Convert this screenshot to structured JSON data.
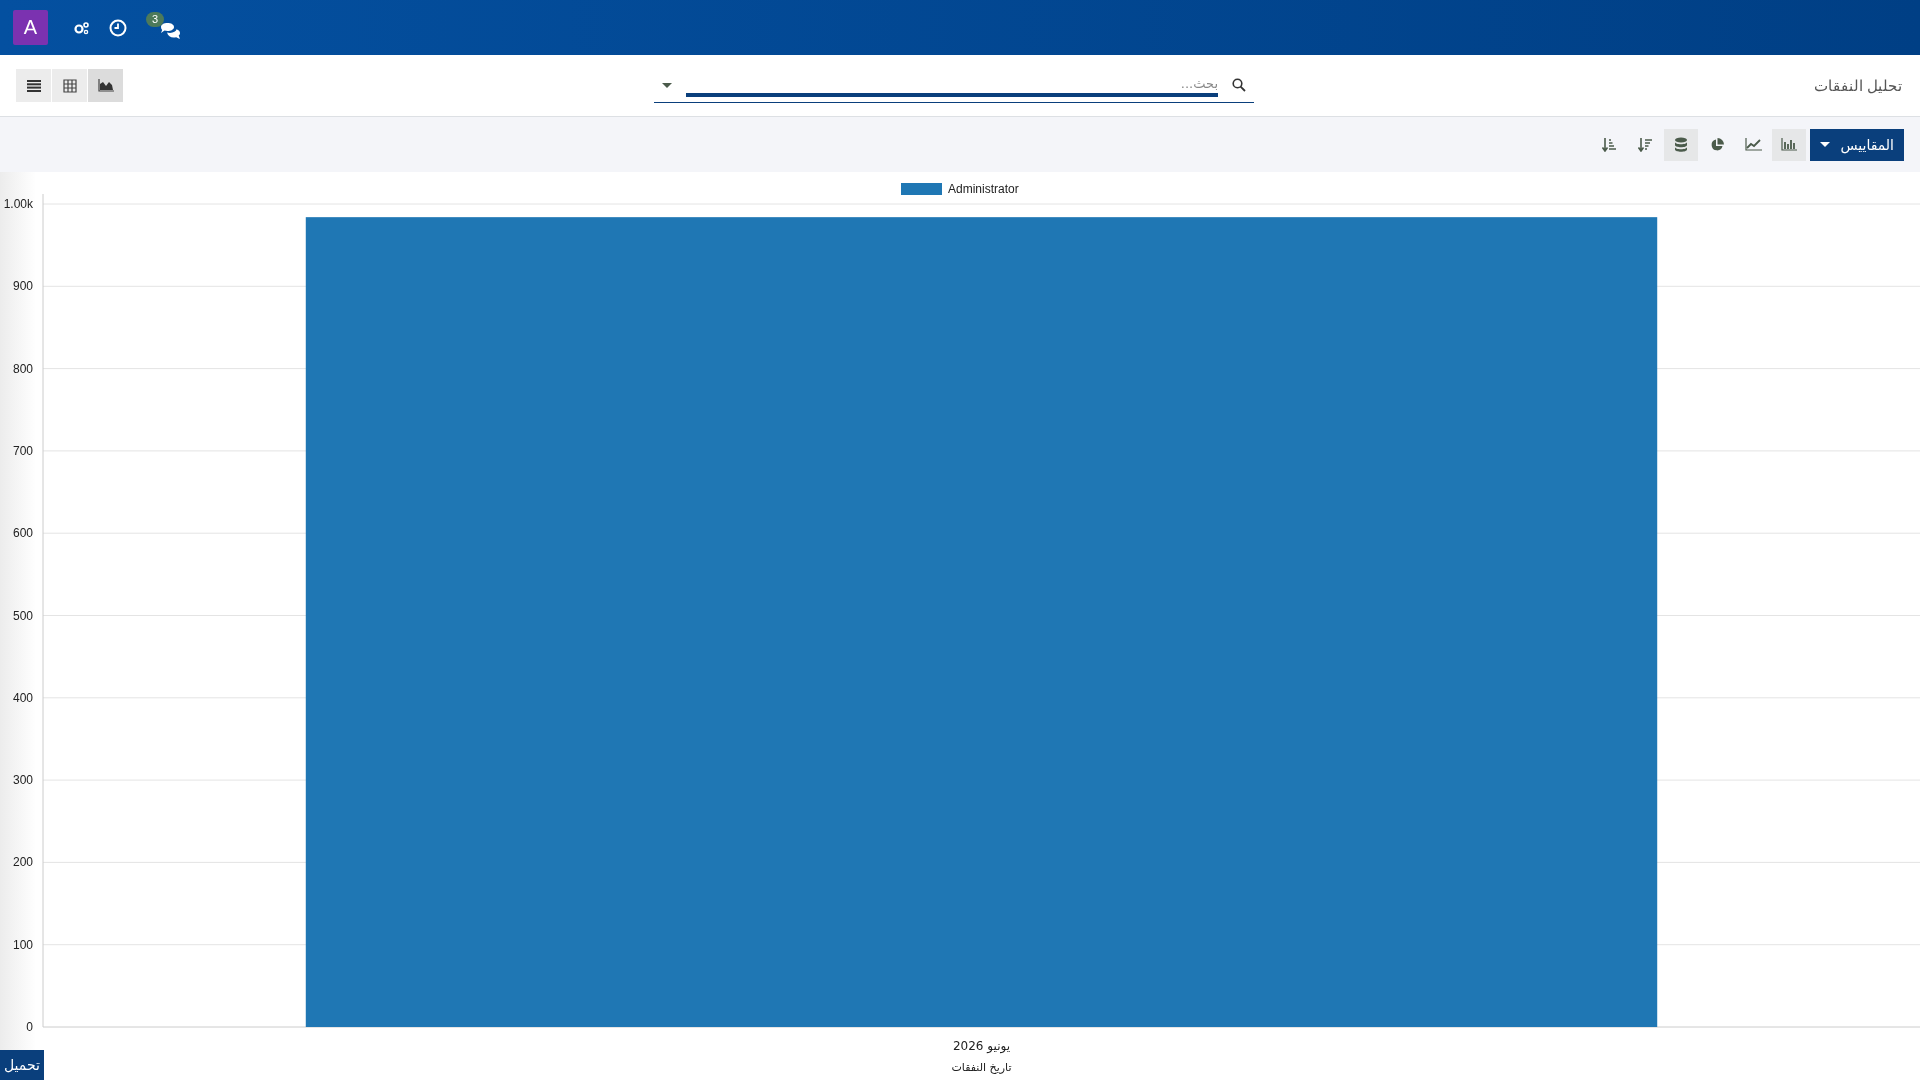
{
  "top_bar": {
    "avatar": "A",
    "chat_badge": "3"
  },
  "control_panel": {
    "title": "تحليل النفقات",
    "search": {
      "placeholder": "بحث..."
    },
    "views": [
      {
        "kind": "list",
        "selected": false
      },
      {
        "kind": "pivot",
        "selected": false
      },
      {
        "kind": "graph",
        "selected": true
      }
    ]
  },
  "toolbar": {
    "measures": "المقاييس",
    "buttons": [
      {
        "kind": "bar",
        "selected": true
      },
      {
        "kind": "line",
        "selected": false
      },
      {
        "kind": "pie",
        "selected": false
      },
      {
        "kind": "stack",
        "selected": true
      },
      {
        "kind": "sort_desc",
        "selected": false
      },
      {
        "kind": "sort_asc",
        "selected": false
      }
    ]
  },
  "chart": {
    "chart_data": {
      "type": "bar",
      "xlabel": "تاريخ النفقات",
      "categories": [
        "يونيو 2026"
      ],
      "series": [
        {
          "name": "Administrator",
          "color": "#1f77b4",
          "values": [
            984
          ]
        }
      ],
      "grid": true,
      "ylim": [
        0,
        1000
      ],
      "yticks": [
        0,
        100,
        200,
        300,
        400,
        500,
        600,
        700,
        800,
        900,
        {
          "value": 1000,
          "label": "1.00k"
        }
      ]
    }
  },
  "download_button": "تحميل"
}
